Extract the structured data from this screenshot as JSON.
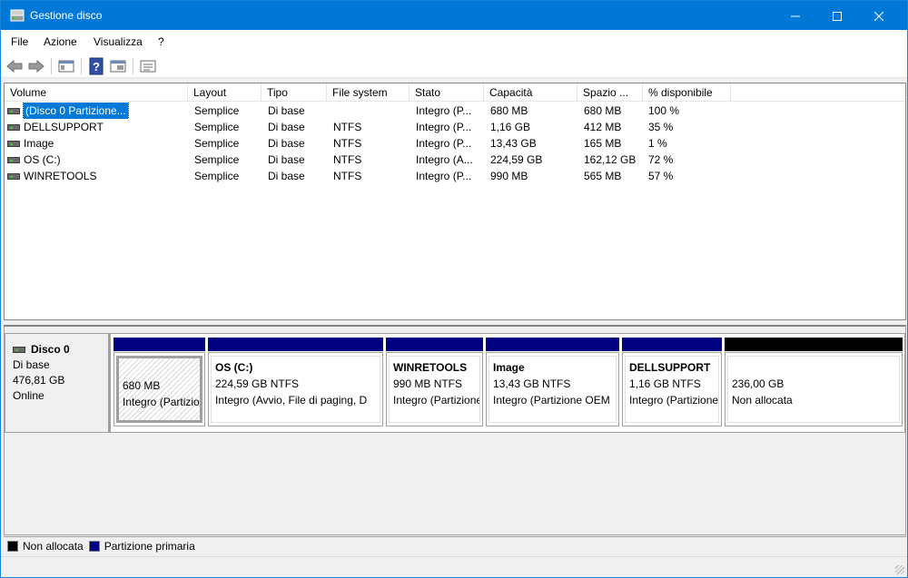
{
  "window": {
    "title": "Gestione disco"
  },
  "menu": [
    "File",
    "Azione",
    "Visualizza",
    "?"
  ],
  "columns": [
    "Volume",
    "Layout",
    "Tipo",
    "File system",
    "Stato",
    "Capacità",
    "Spazio ...",
    "% disponibile"
  ],
  "volumes": [
    {
      "volume": "(Disco 0 Partizione...",
      "layout": "Semplice",
      "tipo": "Di base",
      "fs": "",
      "stato": "Integro (P...",
      "capacita": "680 MB",
      "spazio": "680 MB",
      "perc": "100 %"
    },
    {
      "volume": "DELLSUPPORT",
      "layout": "Semplice",
      "tipo": "Di base",
      "fs": "NTFS",
      "stato": "Integro (P...",
      "capacita": "1,16 GB",
      "spazio": "412 MB",
      "perc": "35 %"
    },
    {
      "volume": "Image",
      "layout": "Semplice",
      "tipo": "Di base",
      "fs": "NTFS",
      "stato": "Integro (P...",
      "capacita": "13,43 GB",
      "spazio": "165 MB",
      "perc": "1 %"
    },
    {
      "volume": "OS (C:)",
      "layout": "Semplice",
      "tipo": "Di base",
      "fs": "NTFS",
      "stato": "Integro (A...",
      "capacita": "224,59 GB",
      "spazio": "162,12 GB",
      "perc": "72 %"
    },
    {
      "volume": "WINRETOOLS",
      "layout": "Semplice",
      "tipo": "Di base",
      "fs": "NTFS",
      "stato": "Integro (P...",
      "capacita": "990 MB",
      "spazio": "565 MB",
      "perc": "57 %"
    }
  ],
  "disk": {
    "name": "Disco 0",
    "type": "Di base",
    "size": "476,81 GB",
    "status": "Online"
  },
  "partitions": [
    {
      "title": "",
      "size": "680 MB",
      "status": "Integro (Partizione",
      "bar": "primary",
      "hatched": true
    },
    {
      "title": "OS  (C:)",
      "size": "224,59 GB NTFS",
      "status": "Integro (Avvio, File di paging, D",
      "bar": "primary",
      "hatched": false
    },
    {
      "title": "WINRETOOLS",
      "size": "990 MB NTFS",
      "status": "Integro (Partizione",
      "bar": "primary",
      "hatched": false
    },
    {
      "title": "Image",
      "size": "13,43 GB NTFS",
      "status": "Integro (Partizione OEM",
      "bar": "primary",
      "hatched": false
    },
    {
      "title": "DELLSUPPORT",
      "size": "1,16 GB NTFS",
      "status": "Integro (Partizione",
      "bar": "primary",
      "hatched": false
    },
    {
      "title": "",
      "size": "236,00 GB",
      "status": "Non allocata",
      "bar": "unallocated",
      "hatched": false
    }
  ],
  "legend": [
    {
      "label": "Non allocata",
      "color": "#000000"
    },
    {
      "label": "Partizione primaria",
      "color": "#000080"
    }
  ],
  "colors": {
    "titlebar": "#0078d7",
    "primary": "#000080",
    "unallocated": "#000000",
    "selection": "#0078d7"
  },
  "icons": [
    "back-arrow-icon",
    "forward-arrow-icon",
    "properties-icon",
    "help-icon",
    "console-icon",
    "settings-icon"
  ]
}
